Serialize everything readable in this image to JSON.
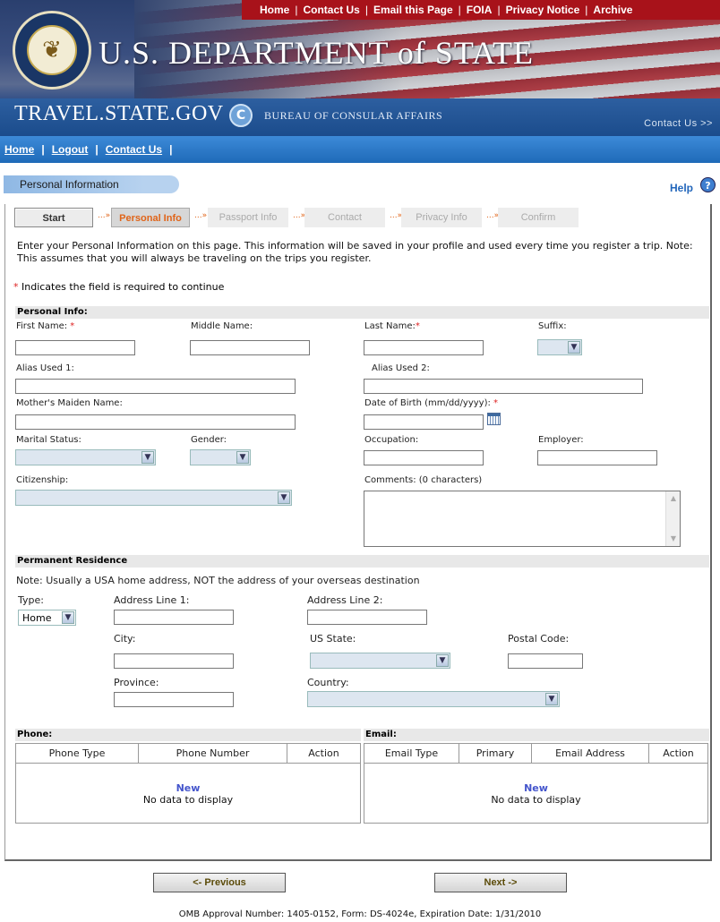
{
  "banner": {
    "top_links": [
      "Home",
      "Contact Us",
      "Email this Page",
      "FOIA",
      "Privacy Notice",
      "Archive"
    ],
    "seal_text": "DEPARTMENT OF STATE · UNITED STATES OF AMERICA",
    "dept_title": "U.S. DEPARTMENT of STATE",
    "site_title": "TRAVEL.STATE.GOV",
    "badge_letter": "C",
    "bureau": "BUREAU OF CONSULAR AFFAIRS",
    "contact": "Contact Us >>"
  },
  "subnav": {
    "items": [
      "Home",
      "Logout",
      "Contact Us"
    ]
  },
  "page_tab": "Personal Information",
  "help": "Help",
  "help_icon": "?",
  "steps": [
    "Start",
    "Personal Info",
    "Passport Info",
    "Contact",
    "Privacy Info",
    "Confirm"
  ],
  "step_arrow": "...»",
  "intro": "Enter your Personal Information on this page. This information will be saved in your profile and used every time you register a trip. Note: This assumes that you will always be traveling on the trips you register.",
  "required_note": "Indicates the field is required to continue",
  "required_mark": "*",
  "personal": {
    "header": "Personal Info:",
    "first_name": "First Name:",
    "middle_name": "Middle Name:",
    "last_name": "Last Name:",
    "suffix": "Suffix:",
    "alias1": "Alias Used 1:",
    "alias2": "Alias Used 2:",
    "maiden": "Mother's Maiden Name:",
    "dob": "Date of Birth (mm/dd/yyyy):",
    "marital": "Marital Status:",
    "gender": "Gender:",
    "occupation": "Occupation:",
    "employer": "Employer:",
    "citizenship": "Citizenship:",
    "comments": "Comments: (0 characters)"
  },
  "residence": {
    "header": "Permanent Residence",
    "note": "Note: Usually a USA home address, NOT the address of your overseas destination",
    "type": "Type:",
    "type_value": "Home",
    "addr1": "Address Line 1:",
    "addr2": "Address Line 2:",
    "city": "City:",
    "state": "US State:",
    "postal": "Postal Code:",
    "province": "Province:",
    "country": "Country:"
  },
  "phone": {
    "header": "Phone:",
    "columns": [
      "Phone Type",
      "Phone Number",
      "Action"
    ],
    "new": "New",
    "empty": "No data to display"
  },
  "email": {
    "header": "Email:",
    "columns": [
      "Email Type",
      "Primary",
      "Email Address",
      "Action"
    ],
    "new": "New",
    "empty": "No data to display"
  },
  "buttons": {
    "previous": "<- Previous",
    "next": "Next ->"
  },
  "footer": "OMB Approval Number: 1405-0152, Form:  DS-4024e, Expiration Date:  1/31/2010"
}
